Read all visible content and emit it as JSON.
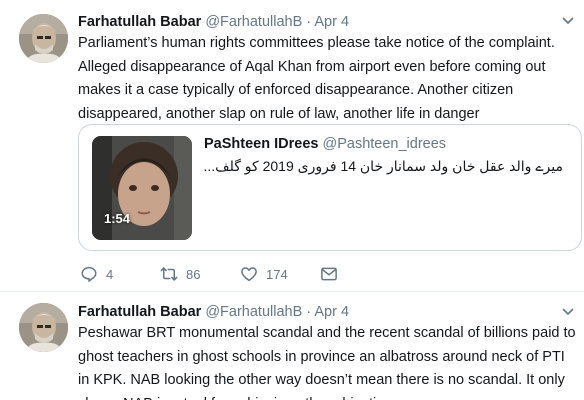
{
  "tweets": [
    {
      "author_name": "Farhatullah Babar",
      "author_handle": "@FarhatullahB",
      "separator": "·",
      "date": "Apr 4",
      "text": "Parliament’s human rights committees please take notice of the complaint. Alleged disappearance of Aqal Khan from airport even before coming out makes it a case typically of enforced disappearance. Another citizen disappeared, another slap on rule of law, another life in danger",
      "quoted": {
        "author_name": "PaShteen IDrees",
        "author_handle": "@Pashteen_idrees",
        "text": "میرے والد عقل خان ولد سمانار خان 14 فروری 2019 کو گلف...",
        "video_duration": "1:54"
      },
      "actions": {
        "replies": "4",
        "retweets": "86",
        "likes": "174"
      }
    },
    {
      "author_name": "Farhatullah Babar",
      "author_handle": "@FarhatullahB",
      "separator": "·",
      "date": "Apr 4",
      "text": "Peshawar BRT monumental scandal and the recent scandal of billions paid to ghost teachers in ghost schools in province an albatross around neck of PTI in KPK. NAB looking the other way doesn’t mean there is no scandal. It only shows NAB is a tool for achieving other objectives"
    }
  ],
  "colors": {
    "text": "#14171a",
    "secondary": "#657786",
    "border": "#ccd6dd"
  },
  "icons": [
    "chevron-down-icon",
    "reply-icon",
    "retweet-icon",
    "like-icon",
    "direct-message-icon",
    "video-thumbnail"
  ]
}
